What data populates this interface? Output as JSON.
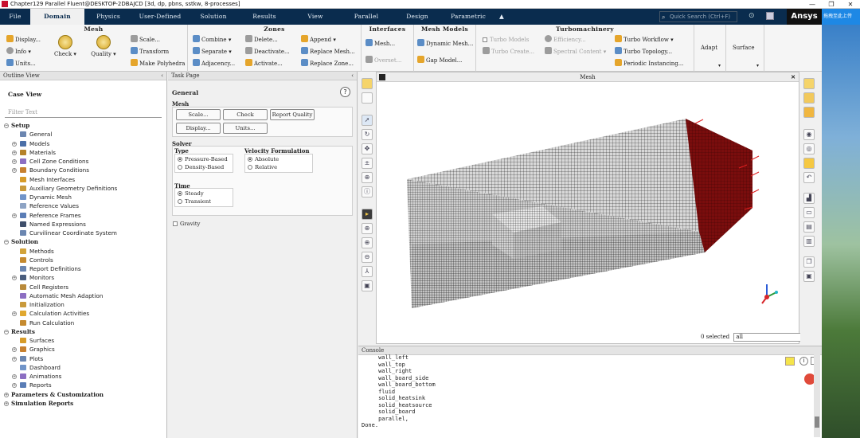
{
  "window": {
    "title": "Chapter129 Parallel Fluent@DESKTOP-2DBAJCD  [3d, dp, pbns, sstkw, 8-processes]",
    "controls": [
      "—",
      "❐",
      "✕"
    ]
  },
  "menubar": {
    "tabs": [
      "File",
      "Domain",
      "Physics",
      "User-Defined",
      "Solution",
      "Results",
      "View",
      "Parallel",
      "Design",
      "Parametric"
    ],
    "active": "Domain",
    "search_placeholder": "Quick Search (Ctrl+F)",
    "brand": "Ansys"
  },
  "ribbon": {
    "mesh": {
      "title": "Mesh",
      "display": "Display...",
      "info": "Info",
      "units": "Units...",
      "check": "Check",
      "quality": "Quality",
      "scale": "Scale...",
      "transform": "Transform",
      "make_polyhedra": "Make Polyhedra"
    },
    "zones": {
      "title": "Zones",
      "combine": "Combine",
      "separate": "Separate",
      "adjacency": "Adjacency...",
      "delete": "Delete...",
      "deactivate": "Deactivate...",
      "activate": "Activate...",
      "append": "Append",
      "replace_mesh": "Replace Mesh...",
      "replace_zone": "Replace Zone..."
    },
    "interfaces": {
      "title": "Interfaces",
      "mesh": "Mesh...",
      "overset": "Overset..."
    },
    "mesh_models": {
      "title": "Mesh Models",
      "dynamic_mesh": "Dynamic Mesh...",
      "gap_model": "Gap Model..."
    },
    "turbomachinery": {
      "title": "Turbomachinery",
      "turbo_models": "Turbo Models",
      "turbo_create": "Turbo Create...",
      "efficiency": "Efficiency...",
      "spectral_content": "Spectral Content",
      "turbo_workflow": "Turbo Workflow",
      "turbo_topology": "Turbo Topology...",
      "periodic_instancing": "Periodic Instancing..."
    },
    "adapt": {
      "title": "Adapt"
    },
    "surface": {
      "title": "Surface"
    }
  },
  "outline": {
    "header": "Outline View",
    "case_view": "Case View",
    "filter_placeholder": "Filter Text",
    "tree": [
      {
        "label": "Setup",
        "type": "sec",
        "exp": "−"
      },
      {
        "label": "General",
        "type": "item",
        "icon": "#6b86b0"
      },
      {
        "label": "Models",
        "type": "item",
        "exp": "+",
        "icon": "#4b6fa8"
      },
      {
        "label": "Materials",
        "type": "item",
        "exp": "+",
        "icon": "#b5822b"
      },
      {
        "label": "Cell Zone Conditions",
        "type": "item",
        "exp": "+",
        "icon": "#8c6ec2"
      },
      {
        "label": "Boundary Conditions",
        "type": "item",
        "exp": "+",
        "icon": "#c7802f"
      },
      {
        "label": "Mesh Interfaces",
        "type": "item",
        "icon": "#d79b28"
      },
      {
        "label": "Auxiliary Geometry Definitions",
        "type": "item",
        "icon": "#c99a3b"
      },
      {
        "label": "Dynamic Mesh",
        "type": "item",
        "icon": "#7094c9"
      },
      {
        "label": "Reference Values",
        "type": "item",
        "icon": "#8da3c4"
      },
      {
        "label": "Reference Frames",
        "type": "item",
        "exp": "+",
        "icon": "#5a7db6"
      },
      {
        "label": "Named Expressions",
        "type": "item",
        "icon": "#3f4f6b"
      },
      {
        "label": "Curvilinear Coordinate System",
        "type": "item",
        "icon": "#6b86b0"
      },
      {
        "label": "Solution",
        "type": "sec",
        "exp": "−"
      },
      {
        "label": "Methods",
        "type": "item",
        "icon": "#d2a33a"
      },
      {
        "label": "Controls",
        "type": "item",
        "icon": "#c58a2f"
      },
      {
        "label": "Report Definitions",
        "type": "item",
        "icon": "#6b86b0"
      },
      {
        "label": "Monitors",
        "type": "item",
        "exp": "+",
        "icon": "#4a5d7d"
      },
      {
        "label": "Cell Registers",
        "type": "item",
        "icon": "#b98a3a"
      },
      {
        "label": "Automatic Mesh Adaption",
        "type": "item",
        "icon": "#8c6ec2"
      },
      {
        "label": "Initialization",
        "type": "item",
        "icon": "#c99a3b"
      },
      {
        "label": "Calculation Activities",
        "type": "item",
        "exp": "+",
        "icon": "#e0a830"
      },
      {
        "label": "Run Calculation",
        "type": "item",
        "icon": "#c58a2f"
      },
      {
        "label": "Results",
        "type": "sec",
        "exp": "−"
      },
      {
        "label": "Surfaces",
        "type": "item",
        "icon": "#d79b28"
      },
      {
        "label": "Graphics",
        "type": "item",
        "exp": "+",
        "icon": "#c7802f"
      },
      {
        "label": "Plots",
        "type": "item",
        "exp": "+",
        "icon": "#6b86b0"
      },
      {
        "label": "Dashboard",
        "type": "item",
        "icon": "#7094c9"
      },
      {
        "label": "Animations",
        "type": "item",
        "exp": "+",
        "icon": "#8c6ec2"
      },
      {
        "label": "Reports",
        "type": "item",
        "exp": "+",
        "icon": "#5a7db6"
      },
      {
        "label": "Parameters & Customization",
        "type": "sec",
        "exp": "+"
      },
      {
        "label": "Simulation Reports",
        "type": "sec",
        "exp": "+"
      }
    ]
  },
  "taskpage": {
    "header": "Task Page",
    "title": "General",
    "help": "?",
    "mesh_label": "Mesh",
    "scale": "Scale...",
    "check": "Check",
    "report_quality": "Report Quality",
    "display": "Display...",
    "units": "Units...",
    "solver_label": "Solver",
    "type_label": "Type",
    "pressure_based": "Pressure-Based",
    "density_based": "Density-Based",
    "velocity_label": "Velocity Formulation",
    "absolute": "Absolute",
    "relative": "Relative",
    "time_label": "Time",
    "steady": "Steady",
    "transient": "Transient",
    "gravity": "Gravity"
  },
  "graphics": {
    "title": "Mesh",
    "close": "✕",
    "selected_count": "0 selected",
    "selection_filter": "all"
  },
  "console": {
    "header": "Console",
    "lines": [
      "     wall_left",
      "     wall_top",
      "     wall_right",
      "     wall_board_side",
      "     wall_board_bottom",
      "     fluid",
      "     solid_heatsink",
      "     solid_heatsource",
      "     solid_board",
      "     parallel,",
      "Done."
    ]
  },
  "desktop": {
    "banner": "拖拽至此上传"
  }
}
